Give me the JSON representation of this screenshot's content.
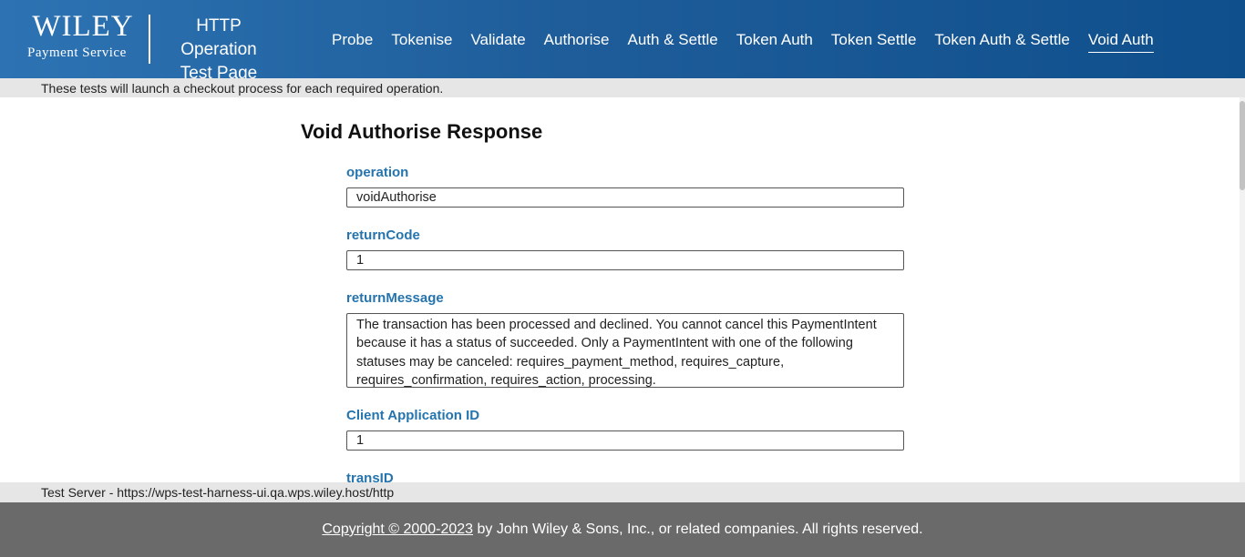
{
  "header": {
    "logo_word": "WILEY",
    "logo_sub": "Payment Service",
    "title_line1": "HTTP Operation",
    "title_line2": "Test Page",
    "nav": [
      "Probe",
      "Tokenise",
      "Validate",
      "Authorise",
      "Auth & Settle",
      "Token Auth",
      "Token Settle",
      "Token Auth & Settle",
      "Void Auth"
    ],
    "active_nav": "Void Auth"
  },
  "info_text": "These tests will launch a checkout process for each required operation.",
  "section_title": "Void Authorise Response",
  "fields": [
    {
      "label": "operation",
      "value": "voidAuthorise"
    },
    {
      "label": "returnCode",
      "value": "1"
    },
    {
      "label": "returnMessage",
      "value": "The transaction has been processed and declined. You cannot cancel this PaymentIntent because it has a status of succeeded. Only a PaymentIntent with one of the following statuses may be canceled: requires_payment_method, requires_capture, requires_confirmation, requires_action, processing."
    },
    {
      "label": "Client Application ID",
      "value": "1"
    },
    {
      "label": "transID",
      "value": ""
    }
  ],
  "server_text": "Test Server - https://wps-test-harness-ui.qa.wps.wiley.host/http",
  "footer": {
    "link_text": "Copyright © 2000-2023",
    "rest_text": " by John Wiley & Sons, Inc., or related companies. All rights reserved."
  },
  "colors": {
    "header": "#1e5d9a",
    "label": "#2574ad",
    "footer": "#6a6a6a",
    "bar": "#e6e6e6"
  }
}
